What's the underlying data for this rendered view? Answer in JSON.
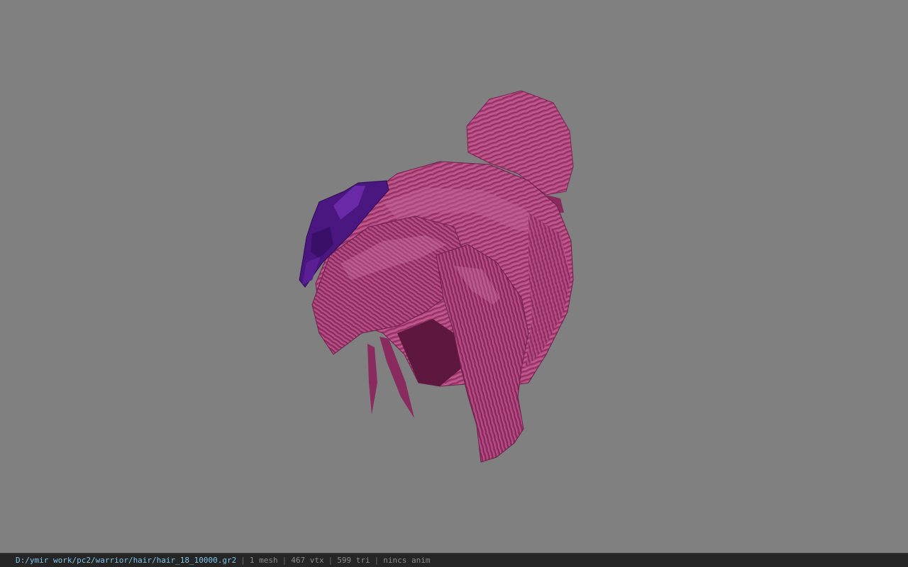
{
  "viewport": {
    "background_color": "#808080",
    "model": {
      "description_icon": "hair-mesh-model",
      "hair_color": "#b0447e",
      "flower_color": "#4a1780"
    }
  },
  "statusbar": {
    "file_path": "D:/ymir work/pc2/warrior/hair/hair_18_10000.gr2",
    "separator": "|",
    "mesh_count": "1 mesh",
    "vertex_count": "467 vtx",
    "triangle_count": "599 tri",
    "anim_status": "nincs anim",
    "path_color": "#7fc3e6"
  }
}
